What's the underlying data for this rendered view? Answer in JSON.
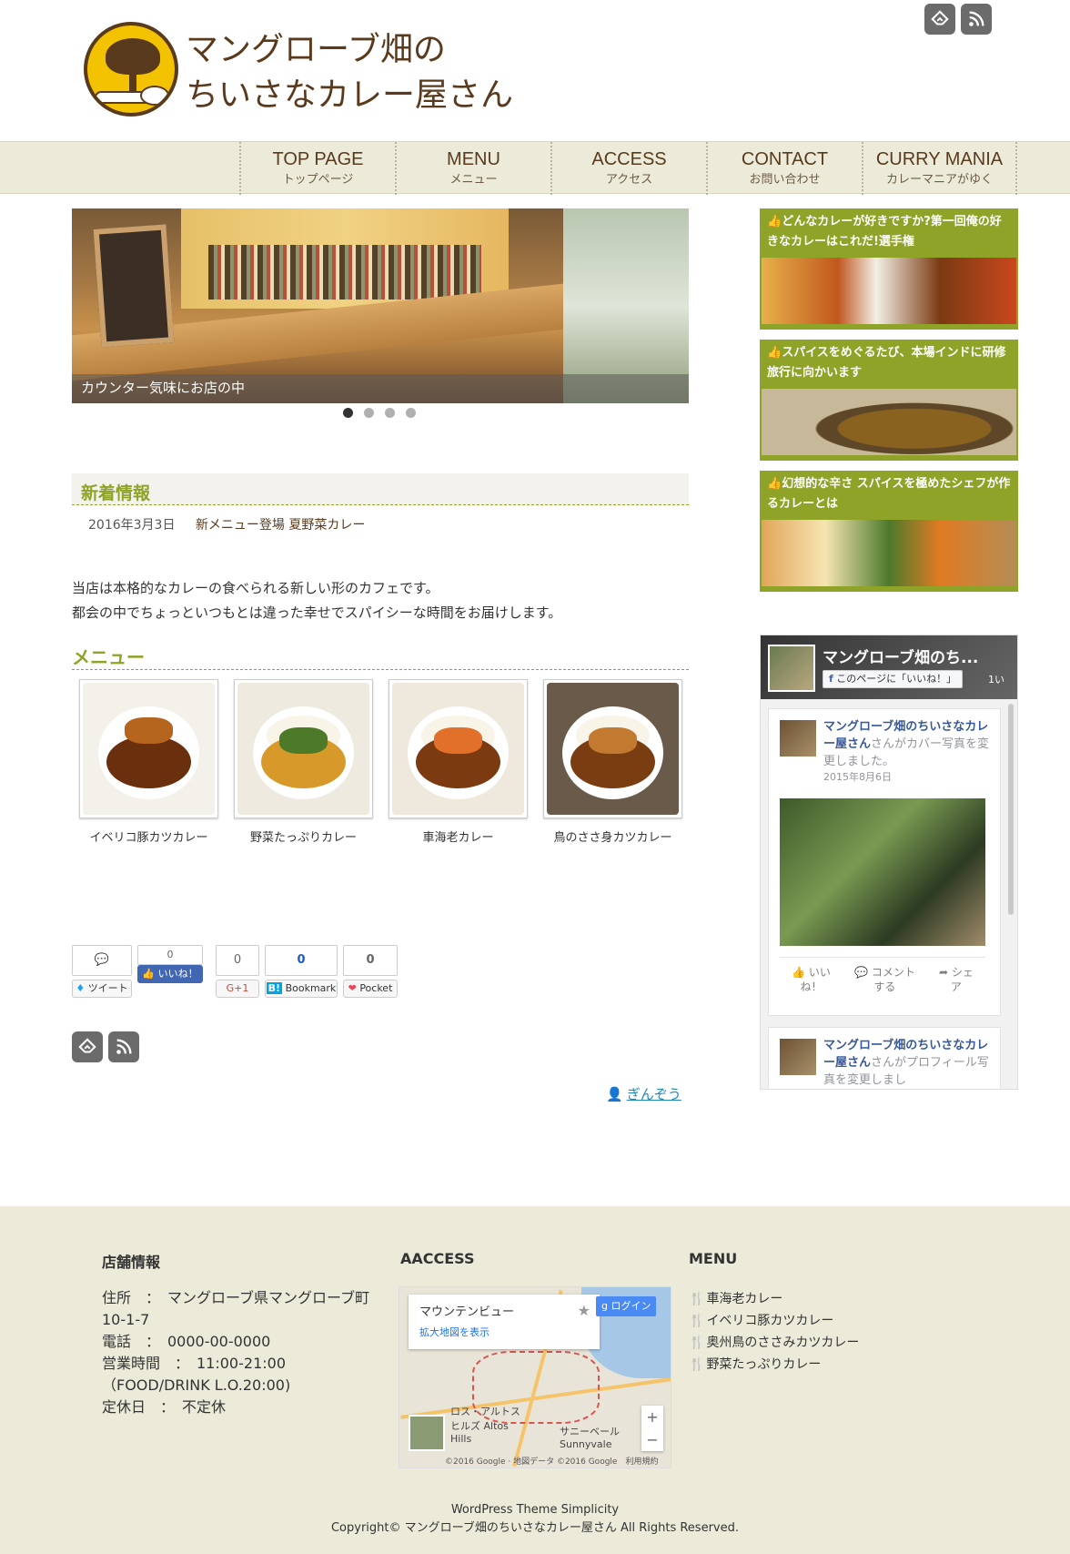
{
  "header": {
    "site_title_line1": "マングローブ畑の",
    "site_title_line2": "ちいさなカレー屋さん",
    "icons": [
      "feedly-icon",
      "rss-icon"
    ]
  },
  "nav": [
    {
      "en": "TOP PAGE",
      "ja": "トップページ"
    },
    {
      "en": "MENU",
      "ja": "メニュー"
    },
    {
      "en": "ACCESS",
      "ja": "アクセス"
    },
    {
      "en": "CONTACT",
      "ja": "お問い合わせ"
    },
    {
      "en": "CURRY MANIA",
      "ja": "カレーマニアがゆく"
    }
  ],
  "slider": {
    "caption": "カウンター気味にお店の中",
    "slides": 4,
    "active_slide": 1
  },
  "news": {
    "heading": "新着情報",
    "items": [
      {
        "date": "2016年3月3日",
        "title": "新メニュー登場 夏野菜カレー"
      }
    ]
  },
  "intro": {
    "line1": "当店は本格的なカレーの食べられる新しい形のカフェです。",
    "line2": "都会の中でちょっといつもとは違った幸せでスパイシーな時間をお届けします。"
  },
  "menu": {
    "heading": "メニュー",
    "items": [
      "イベリコ豚カツカレー",
      "野菜たっぷりカレー",
      "車海老カレー",
      "鳥のささ身カツカレー"
    ]
  },
  "social": {
    "twitter_label": "ツイート",
    "facebook_count": "0",
    "facebook_label": "いいね！",
    "gplus_count": "0",
    "gplus_label": "G+1",
    "hatena_count": "0",
    "hatena_label": "Bookmark",
    "pocket_count": "0",
    "pocket_label": "Pocket"
  },
  "author": "ぎんぞう",
  "sidebar": {
    "cards": [
      {
        "title": "どんなカレーが好きですか?第一回俺の好きなカレーはこれだ!選手権"
      },
      {
        "title": "スパイスをめぐるたび、本場インドに研修旅行に向かいます"
      },
      {
        "title": "幻想的な辛さ スパイスを極めたシェフが作るカレーとは"
      }
    ],
    "facebook": {
      "page_name": "マングローブ畑のち...",
      "like_label": "このページに「いいね！」",
      "like_count": "1い",
      "post1_name": "マングローブ畑のちいさなカレー屋さん",
      "post1_text": "さんがカバー写真を変更しました。",
      "post1_date": "2015年8月6日",
      "action_like": "いい\nね！",
      "action_comment": "コメント\nする",
      "action_share": "シェ\nア",
      "post2_name": "マングローブ畑のちいさなカレー屋さん",
      "post2_text": "さんがプロフィール写真を変更しまし"
    }
  },
  "footer": {
    "store_title": "店舗情報",
    "store_lines": [
      "住所　：　マングローブ県マングローブ町10-1-7",
      "電話　：　0000-00-0000",
      "営業時間　：　11:00-21:00（FOOD/DRINK L.O.20:00)",
      "定休日　：　不定休"
    ],
    "access_title": "AACCESS",
    "map": {
      "place": "マウンテンビュー",
      "link": "拡大地図を表示",
      "login": "ログイン",
      "label_altos": "ロス・アルトスヒルズ Altos Hills",
      "label_sunny": "サニーベール Sunnyvale",
      "credit": "©2016 Google · 地図データ ©2016 Google　利用規約"
    },
    "menu_title": "MENU",
    "menu_items": [
      "車海老カレー",
      "イベリコ豚カツカレー",
      "奥州鳥のささみカツカレー",
      "野菜たっぷりカレー"
    ],
    "theme": "WordPress Theme Simplicity",
    "copyright": "Copyright© マングローブ畑のちいさなカレー屋さん All Rights Reserved."
  },
  "colors": {
    "accent": "#8ea327",
    "brown": "#5a3a1c",
    "nav_bg": "#ecebd9",
    "footer_bg": "#ecebd9"
  }
}
